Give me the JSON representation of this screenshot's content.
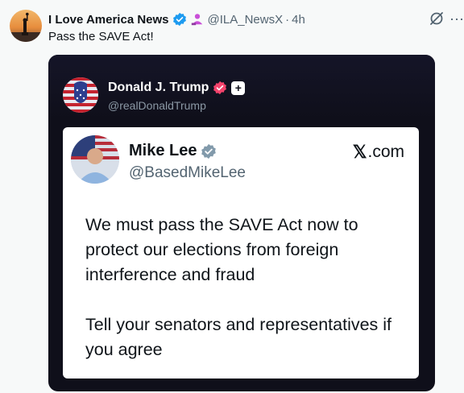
{
  "post": {
    "author_name": "I Love America News",
    "handle": "@ILA_NewsX",
    "separator": "·",
    "time": "4h",
    "text": "Pass the SAVE Act!"
  },
  "embedded": {
    "name": "Donald J. Trump",
    "handle": "@realDonaldTrump",
    "plus_label": "+"
  },
  "card": {
    "name": "Mike Lee",
    "handle": "@BasedMikeLee",
    "brand_x": "𝕏",
    "brand_suffix": ".com",
    "paragraph1": "We must pass the SAVE Act now to protect our elections from foreign interference and fraud",
    "paragraph2": "Tell your senators and representatives if you agree"
  },
  "icons": {
    "verified": "verified-badge-icon",
    "affiliate": "affiliate-badge-icon",
    "grok": "grok-icon",
    "more": "more-icon"
  },
  "colors": {
    "verified_blue": "#1d9bf0",
    "trump_badge": "#f4436c",
    "affiliate_pink": "#c94fd8",
    "media_bg": "#0f0f1a"
  },
  "more_label": "⋯"
}
